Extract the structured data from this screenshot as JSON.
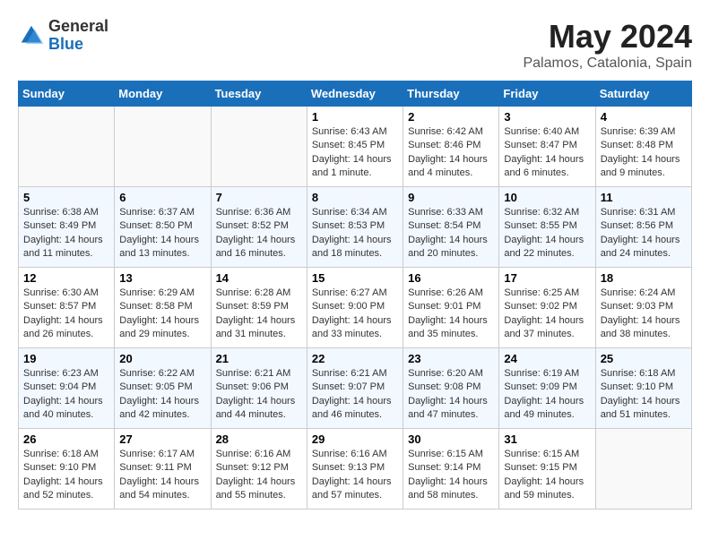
{
  "header": {
    "logo": {
      "general": "General",
      "blue": "Blue"
    },
    "title": "May 2024",
    "location": "Palamos, Catalonia, Spain"
  },
  "weekdays": [
    "Sunday",
    "Monday",
    "Tuesday",
    "Wednesday",
    "Thursday",
    "Friday",
    "Saturday"
  ],
  "weeks": [
    [
      {
        "day": "",
        "info": ""
      },
      {
        "day": "",
        "info": ""
      },
      {
        "day": "",
        "info": ""
      },
      {
        "day": "1",
        "info": "Sunrise: 6:43 AM\nSunset: 8:45 PM\nDaylight: 14 hours\nand 1 minute."
      },
      {
        "day": "2",
        "info": "Sunrise: 6:42 AM\nSunset: 8:46 PM\nDaylight: 14 hours\nand 4 minutes."
      },
      {
        "day": "3",
        "info": "Sunrise: 6:40 AM\nSunset: 8:47 PM\nDaylight: 14 hours\nand 6 minutes."
      },
      {
        "day": "4",
        "info": "Sunrise: 6:39 AM\nSunset: 8:48 PM\nDaylight: 14 hours\nand 9 minutes."
      }
    ],
    [
      {
        "day": "5",
        "info": "Sunrise: 6:38 AM\nSunset: 8:49 PM\nDaylight: 14 hours\nand 11 minutes."
      },
      {
        "day": "6",
        "info": "Sunrise: 6:37 AM\nSunset: 8:50 PM\nDaylight: 14 hours\nand 13 minutes."
      },
      {
        "day": "7",
        "info": "Sunrise: 6:36 AM\nSunset: 8:52 PM\nDaylight: 14 hours\nand 16 minutes."
      },
      {
        "day": "8",
        "info": "Sunrise: 6:34 AM\nSunset: 8:53 PM\nDaylight: 14 hours\nand 18 minutes."
      },
      {
        "day": "9",
        "info": "Sunrise: 6:33 AM\nSunset: 8:54 PM\nDaylight: 14 hours\nand 20 minutes."
      },
      {
        "day": "10",
        "info": "Sunrise: 6:32 AM\nSunset: 8:55 PM\nDaylight: 14 hours\nand 22 minutes."
      },
      {
        "day": "11",
        "info": "Sunrise: 6:31 AM\nSunset: 8:56 PM\nDaylight: 14 hours\nand 24 minutes."
      }
    ],
    [
      {
        "day": "12",
        "info": "Sunrise: 6:30 AM\nSunset: 8:57 PM\nDaylight: 14 hours\nand 26 minutes."
      },
      {
        "day": "13",
        "info": "Sunrise: 6:29 AM\nSunset: 8:58 PM\nDaylight: 14 hours\nand 29 minutes."
      },
      {
        "day": "14",
        "info": "Sunrise: 6:28 AM\nSunset: 8:59 PM\nDaylight: 14 hours\nand 31 minutes."
      },
      {
        "day": "15",
        "info": "Sunrise: 6:27 AM\nSunset: 9:00 PM\nDaylight: 14 hours\nand 33 minutes."
      },
      {
        "day": "16",
        "info": "Sunrise: 6:26 AM\nSunset: 9:01 PM\nDaylight: 14 hours\nand 35 minutes."
      },
      {
        "day": "17",
        "info": "Sunrise: 6:25 AM\nSunset: 9:02 PM\nDaylight: 14 hours\nand 37 minutes."
      },
      {
        "day": "18",
        "info": "Sunrise: 6:24 AM\nSunset: 9:03 PM\nDaylight: 14 hours\nand 38 minutes."
      }
    ],
    [
      {
        "day": "19",
        "info": "Sunrise: 6:23 AM\nSunset: 9:04 PM\nDaylight: 14 hours\nand 40 minutes."
      },
      {
        "day": "20",
        "info": "Sunrise: 6:22 AM\nSunset: 9:05 PM\nDaylight: 14 hours\nand 42 minutes."
      },
      {
        "day": "21",
        "info": "Sunrise: 6:21 AM\nSunset: 9:06 PM\nDaylight: 14 hours\nand 44 minutes."
      },
      {
        "day": "22",
        "info": "Sunrise: 6:21 AM\nSunset: 9:07 PM\nDaylight: 14 hours\nand 46 minutes."
      },
      {
        "day": "23",
        "info": "Sunrise: 6:20 AM\nSunset: 9:08 PM\nDaylight: 14 hours\nand 47 minutes."
      },
      {
        "day": "24",
        "info": "Sunrise: 6:19 AM\nSunset: 9:09 PM\nDaylight: 14 hours\nand 49 minutes."
      },
      {
        "day": "25",
        "info": "Sunrise: 6:18 AM\nSunset: 9:10 PM\nDaylight: 14 hours\nand 51 minutes."
      }
    ],
    [
      {
        "day": "26",
        "info": "Sunrise: 6:18 AM\nSunset: 9:10 PM\nDaylight: 14 hours\nand 52 minutes."
      },
      {
        "day": "27",
        "info": "Sunrise: 6:17 AM\nSunset: 9:11 PM\nDaylight: 14 hours\nand 54 minutes."
      },
      {
        "day": "28",
        "info": "Sunrise: 6:16 AM\nSunset: 9:12 PM\nDaylight: 14 hours\nand 55 minutes."
      },
      {
        "day": "29",
        "info": "Sunrise: 6:16 AM\nSunset: 9:13 PM\nDaylight: 14 hours\nand 57 minutes."
      },
      {
        "day": "30",
        "info": "Sunrise: 6:15 AM\nSunset: 9:14 PM\nDaylight: 14 hours\nand 58 minutes."
      },
      {
        "day": "31",
        "info": "Sunrise: 6:15 AM\nSunset: 9:15 PM\nDaylight: 14 hours\nand 59 minutes."
      },
      {
        "day": "",
        "info": ""
      }
    ]
  ]
}
